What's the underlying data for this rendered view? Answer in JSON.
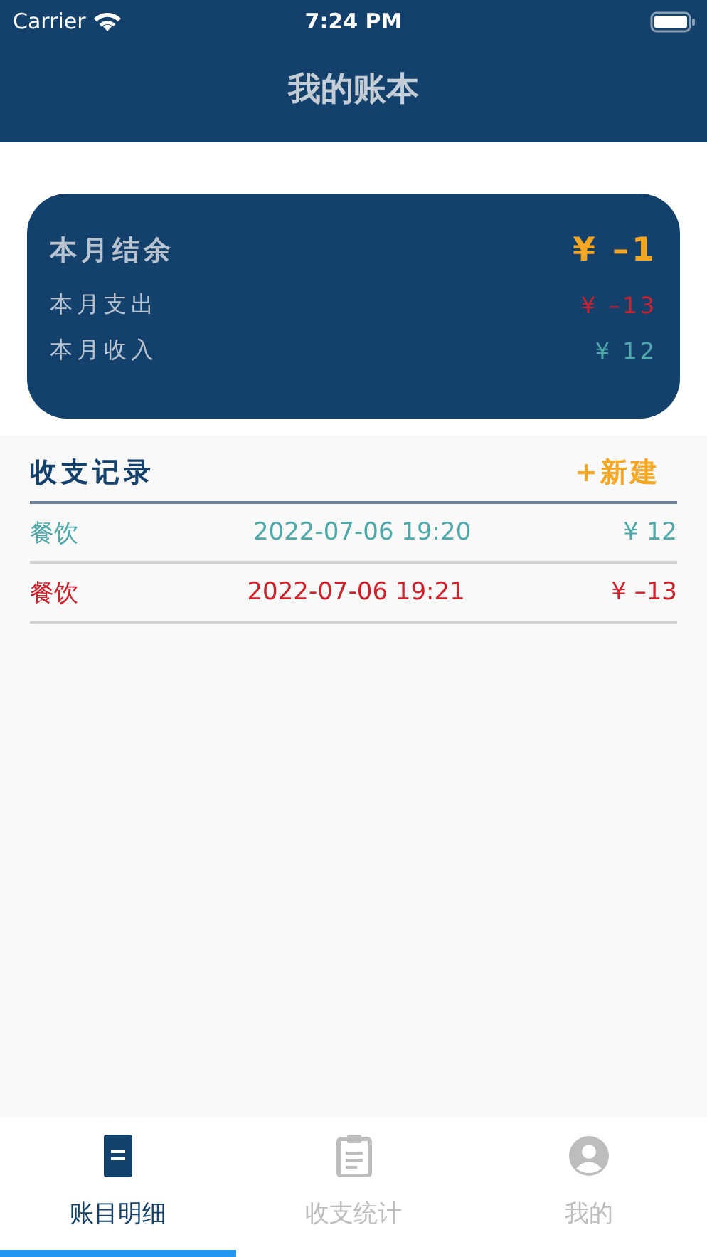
{
  "status_bar": {
    "carrier": "Carrier",
    "time": "7:24 PM"
  },
  "nav_bar": {
    "title": "我的账本"
  },
  "summary": {
    "balance_label": "本月结余",
    "balance": "¥ –1",
    "expense_label": "本月支出",
    "expense": "¥ –13",
    "income_label": "本月收入",
    "income": "¥ 12"
  },
  "records": {
    "title": "收支记录",
    "new_button": "+新建",
    "rows": [
      {
        "kind": "income",
        "category": "餐饮",
        "time": "2022-07-06 19:20",
        "amount": "¥ 12"
      },
      {
        "kind": "expense",
        "category": "餐饮",
        "time": "2022-07-06 19:21",
        "amount": "¥ –13"
      }
    ]
  },
  "tabs": [
    {
      "label": "账目明细",
      "kind": "document",
      "selected": true
    },
    {
      "label": "收支统计",
      "kind": "clipboard",
      "selected": false
    },
    {
      "label": "我的",
      "kind": "person",
      "selected": false
    }
  ]
}
